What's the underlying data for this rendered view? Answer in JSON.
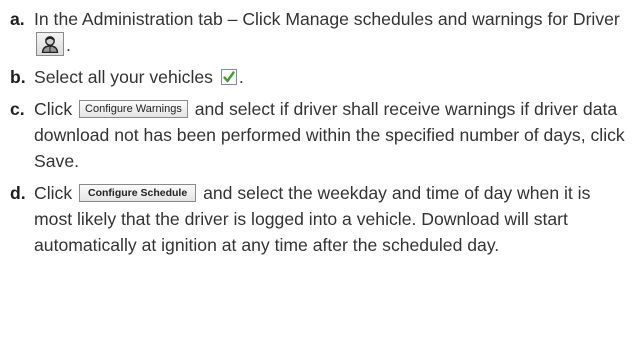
{
  "steps": [
    {
      "letter": "a.",
      "text_before": "In the Administration tab – Click Manage schedules and warnings for Driver",
      "icon": "driver-icon",
      "text_after": "."
    },
    {
      "letter": "b.",
      "text_before": "Select all your vehicles",
      "icon": "checkbox-checked-icon",
      "text_after": "."
    },
    {
      "letter": "c.",
      "text_before": "Click",
      "button_label": "Configure Warnings",
      "text_after": "and select if driver shall receive warnings if driver data download not has been performed within the specified number of days, click Save."
    },
    {
      "letter": "d.",
      "text_before": "Click",
      "button_label": "Configure Schedule",
      "text_after": "and select the weekday and time of day when it is most likely that the driver is logged into a vehicle. Download will start automatically at ignition at any time after the scheduled day."
    }
  ],
  "colors": {
    "text": "#333333",
    "checkmark": "#3aa22a",
    "button_border": "#8a8a8a"
  }
}
